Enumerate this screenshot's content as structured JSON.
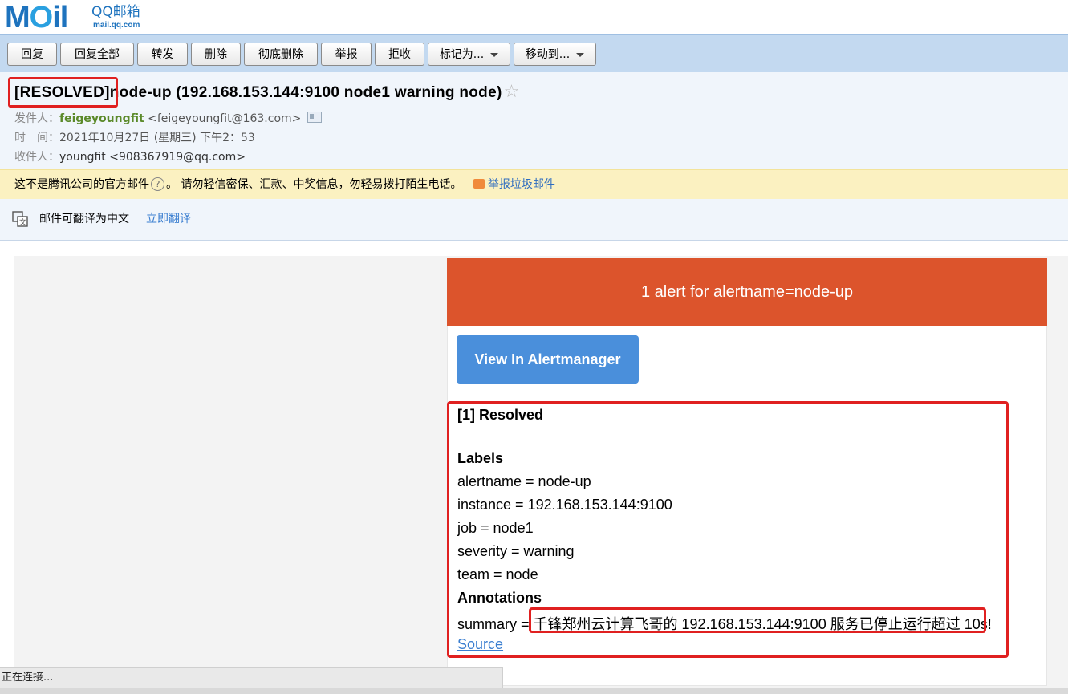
{
  "logo": {
    "mark": "MOil",
    "cn_name": "QQ邮箱",
    "url": "mail.qq.com"
  },
  "toolbar": {
    "buttons": [
      {
        "label": "回复"
      },
      {
        "label": "回复全部"
      },
      {
        "label": "转发"
      },
      {
        "label": "删除"
      },
      {
        "label": "彻底删除"
      },
      {
        "label": "举报"
      },
      {
        "label": "拒收"
      },
      {
        "label": "标记为..."
      },
      {
        "label": "移动到..."
      }
    ]
  },
  "email": {
    "tag": "[RESOLVED]",
    "subject_rest": "node-up (192.168.153.144:9100 node1 warning node)",
    "star": "☆",
    "from_label": "发件人：",
    "from_name": "feigeyoungfit",
    "from_addr": "<feigeyoungfit@163.com>",
    "time_label": "时　间：",
    "time_value": "2021年10月27日 (星期三) 下午2：53",
    "to_label": "收件人：",
    "to_value": "youngfit <908367919@qq.com>"
  },
  "warning": {
    "text1": "这不是腾讯公司的官方邮件",
    "help": "?",
    "text2": "。 请勿轻信密保、汇款、中奖信息，勿轻易拨打陌生电话。",
    "report": "举报垃圾邮件"
  },
  "translate": {
    "label": "邮件可翻译为中文",
    "action": "立即翻译"
  },
  "alert": {
    "header": "1 alert for alertname=node-up",
    "button": "View In Alertmanager",
    "title": "[1] Resolved",
    "labels_heading": "Labels",
    "labels": [
      "alertname = node-up",
      "instance = 192.168.153.144:9100",
      "job = node1",
      "severity = warning",
      "team = node"
    ],
    "annotations_heading": "Annotations",
    "summary_key": "summary = ",
    "summary_value": "千锋郑州云计算飞哥的 192.168.153.144:9100 服务已停止运行超过 10s!",
    "source": "Source"
  },
  "status": {
    "text": "正在连接..."
  },
  "colors": {
    "toolbar_bg": "#c3d9f0",
    "alert_header": "#dc542c",
    "alert_button": "#4a8fdb",
    "highlight_red": "#e02020",
    "sender_green": "#5b8a2a",
    "link_blue": "#3a7ed0"
  }
}
